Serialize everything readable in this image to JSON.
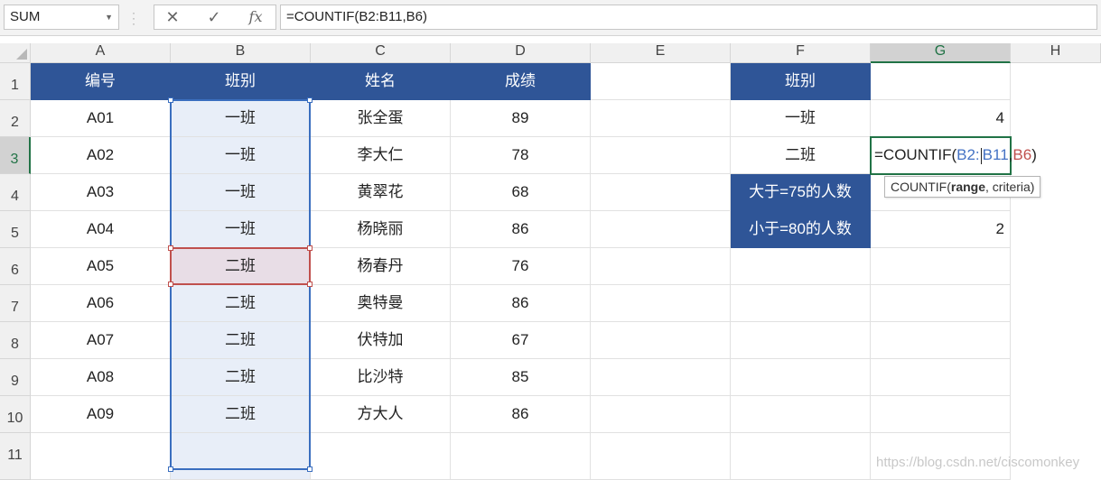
{
  "name_box": {
    "value": "SUM"
  },
  "formula_bar": {
    "cancel": "✕",
    "enter": "✓",
    "fx": "fx",
    "formula": "=COUNTIF(B2:B11,B6)"
  },
  "columns": [
    "A",
    "B",
    "C",
    "D",
    "E",
    "F",
    "G",
    "H"
  ],
  "rows": [
    "1",
    "2",
    "3",
    "4",
    "5",
    "6",
    "7",
    "8",
    "9",
    "10",
    "11"
  ],
  "table": {
    "headers": [
      "编号",
      "班别",
      "姓名",
      "成绩"
    ],
    "records": [
      [
        "A01",
        "一班",
        "张全蛋",
        "89"
      ],
      [
        "A02",
        "一班",
        "李大仁",
        "78"
      ],
      [
        "A03",
        "一班",
        "黄翠花",
        "68"
      ],
      [
        "A04",
        "一班",
        "杨晓丽",
        "86"
      ],
      [
        "A05",
        "二班",
        "杨春丹",
        "76"
      ],
      [
        "A06",
        "二班",
        "奥特曼",
        "86"
      ],
      [
        "A07",
        "二班",
        "伏特加",
        "67"
      ],
      [
        "A08",
        "二班",
        "比沙特",
        "85"
      ],
      [
        "A09",
        "二班",
        "方大人",
        "86"
      ]
    ]
  },
  "summary": {
    "header": "班别",
    "labels": [
      "一班",
      "二班",
      "大于=75的人数",
      "小于=80的人数"
    ],
    "values": [
      "4",
      "",
      "",
      "2"
    ]
  },
  "edit": {
    "prefix": "=COUNTIF(",
    "range_a": "B2:",
    "range_b": "B11",
    "comma": ",",
    "crit_ref": "B6",
    "suffix": ")"
  },
  "tooltip": {
    "fn": "COUNTIF(",
    "arg1": "range",
    "rest": ", criteria)"
  },
  "watermark": "https://blog.csdn.net/ciscomonkey",
  "colors": {
    "header_fill": "#2f5597",
    "range_ref": "#4472c4",
    "crit_ref": "#c0504d",
    "active_cell": "#217346"
  }
}
